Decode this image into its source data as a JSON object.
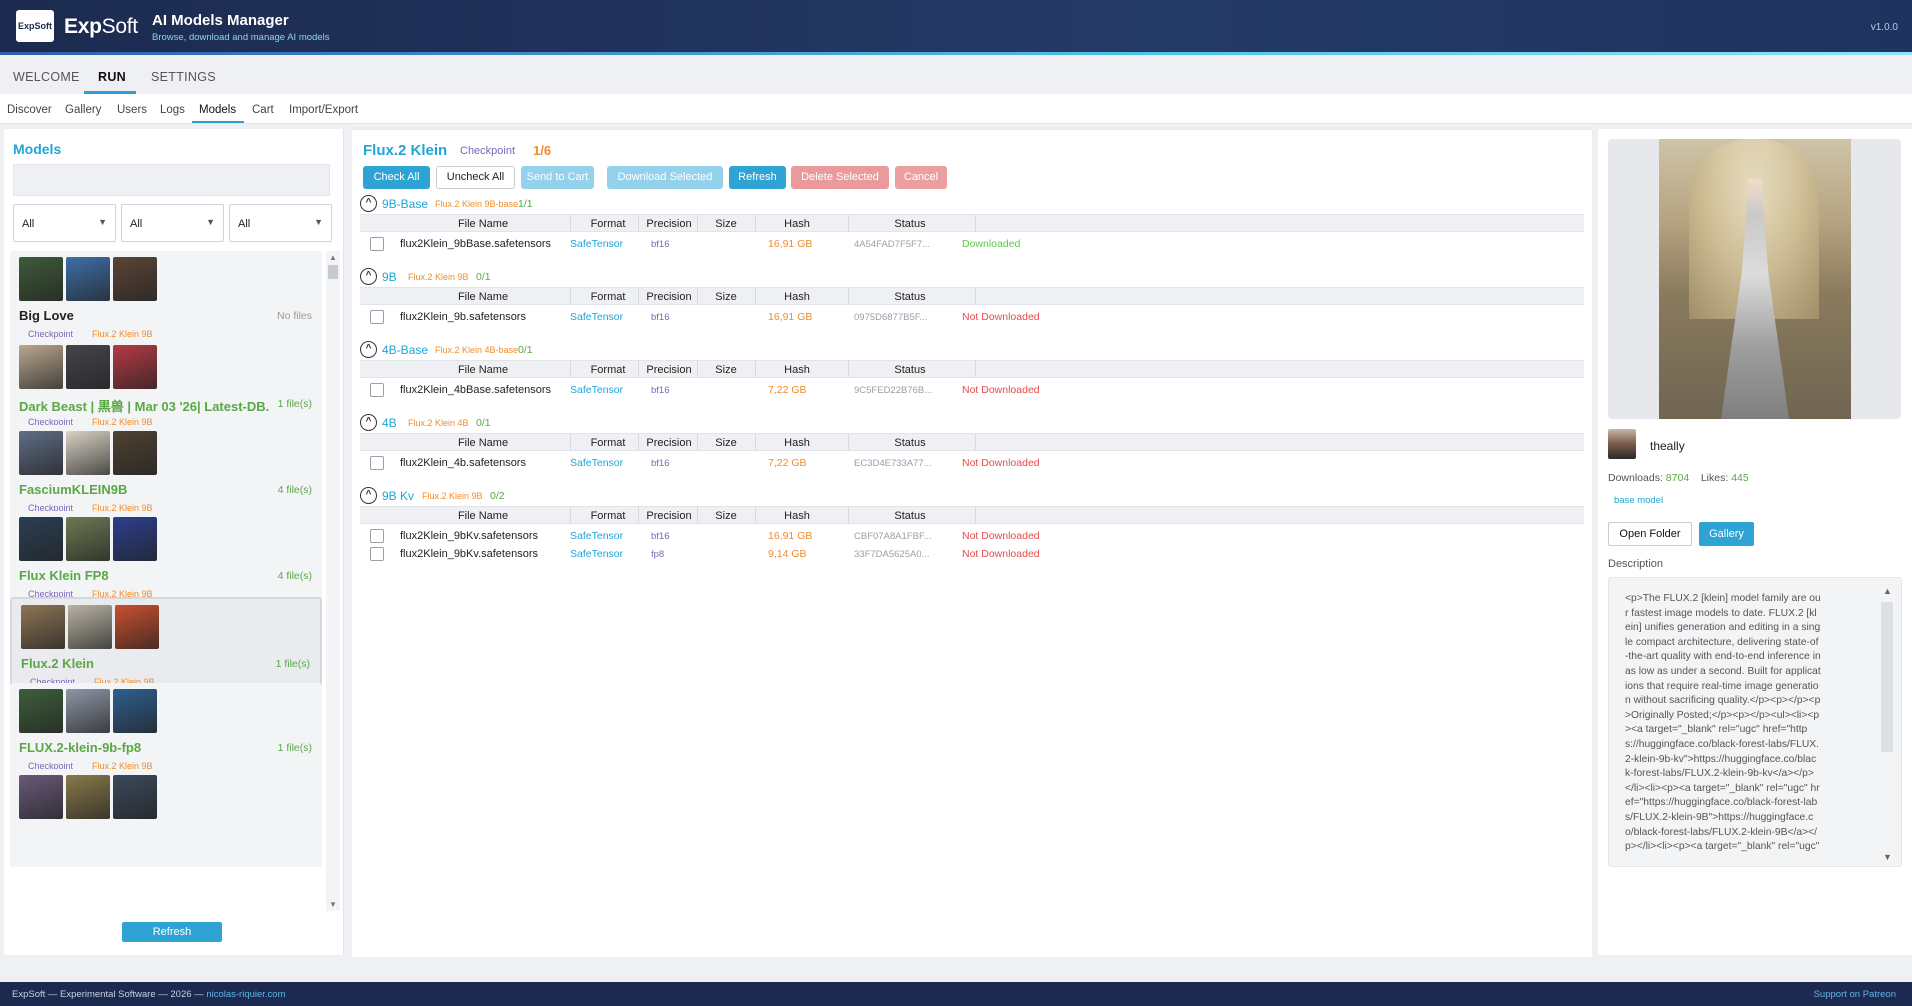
{
  "header": {
    "logo_text": "ExpSoft",
    "brand_main": "Exp",
    "brand_soft": "Soft",
    "app_title": "AI Models Manager",
    "app_subtitle": "Browse, download and manage AI models",
    "version": "v1.0.0"
  },
  "topnav": [
    "WELCOME",
    "RUN",
    "SETTINGS"
  ],
  "subnav": [
    "Discover",
    "Gallery",
    "Users",
    "Logs",
    "Models",
    "Cart",
    "Import/Export"
  ],
  "left": {
    "title": "Models",
    "filters": [
      "All",
      "All",
      "All"
    ],
    "refresh_label": "Refresh",
    "cards": [
      {
        "name": "Big Love",
        "files": "No files",
        "type": "Checkpoint",
        "base": "Flux.2 Klein 9B",
        "colors": [
          "#3e5b3a",
          "#3d6fa8",
          "#5b4536"
        ]
      },
      {
        "name": "Dark Beast | 黒兽 | Mar 03 '26| Latest-DB...",
        "files": "1 file(s)",
        "type": "Checkpoint",
        "base": "Flux.2 Klein 9B",
        "colors": [
          "#b9a78e",
          "#45444a",
          "#b53a44"
        ]
      },
      {
        "name": "FasciumKLEIN9B",
        "files": "4 file(s)",
        "type": "Checkpoint",
        "base": "Flux.2 Klein 9B",
        "colors": [
          "#5f6d86",
          "#d9d2c4",
          "#4e4232"
        ]
      },
      {
        "name": "Flux Klein FP8",
        "files": "4 file(s)",
        "type": "Checkpoint",
        "base": "Flux.2 Klein 9B",
        "colors": [
          "#2a3f54",
          "#6c7a52",
          "#2b3f8f"
        ]
      },
      {
        "name": "Flux.2 Klein",
        "files": "1 file(s)",
        "type": "Checkpoint",
        "base": "Flux.2 Klein 9B",
        "colors": [
          "#8d7553",
          "#b9b3a4",
          "#c9502e"
        ]
      },
      {
        "name": "FLUX.2-klein-9b-fp8",
        "files": "1 file(s)",
        "type": "Checkpoint",
        "base": "Flux.2 Klein 9B",
        "colors": [
          "#3d5f3a",
          "#8d96a7",
          "#2e5f8f"
        ]
      },
      {
        "name": "",
        "files": "",
        "type": "",
        "base": "",
        "colors": [
          "#6a5a7a",
          "#8a7a4a",
          "#3a4a5a"
        ]
      }
    ]
  },
  "center": {
    "title": "Flux.2 Klein",
    "type": "Checkpoint",
    "count": "1/6",
    "buttons": {
      "check_all": "Check All",
      "uncheck_all": "Uncheck All",
      "send_to_cart": "Send to Cart",
      "download_selected": "Download Selected",
      "refresh": "Refresh",
      "delete_selected": "Delete Selected",
      "cancel": "Cancel"
    },
    "columns": [
      "File Name",
      "Format",
      "Precision",
      "Size",
      "Hash",
      "Status"
    ],
    "groups": [
      {
        "name": "9B-Base",
        "base": "Flux.2 Klein 9B-base",
        "count": "1/1",
        "rows": [
          {
            "file": "flux2Klein_9bBase.safetensors",
            "format": "SafeTensor",
            "precision": "bf16",
            "size": "16,91 GB",
            "hash": "4A54FAD7F5F7...",
            "status": "Downloaded",
            "ok": true
          }
        ]
      },
      {
        "name": "9B",
        "base": "Flux.2 Klein 9B",
        "count": "0/1",
        "rows": [
          {
            "file": "flux2Klein_9b.safetensors",
            "format": "SafeTensor",
            "precision": "bf16",
            "size": "16,91 GB",
            "hash": "0975D6877B5F...",
            "status": "Not Downloaded",
            "ok": false
          }
        ]
      },
      {
        "name": "4B-Base",
        "base": "Flux.2 Klein 4B-base",
        "count": "0/1",
        "rows": [
          {
            "file": "flux2Klein_4bBase.safetensors",
            "format": "SafeTensor",
            "precision": "bf16",
            "size": "7,22 GB",
            "hash": "9C5FED22B76B...",
            "status": "Not Downloaded",
            "ok": false
          }
        ]
      },
      {
        "name": "4B",
        "base": "Flux.2 Klein 4B",
        "count": "0/1",
        "rows": [
          {
            "file": "flux2Klein_4b.safetensors",
            "format": "SafeTensor",
            "precision": "bf16",
            "size": "7,22 GB",
            "hash": "EC3D4E733A77...",
            "status": "Not Downloaded",
            "ok": false
          }
        ]
      },
      {
        "name": "9B Kv",
        "base": "Flux.2 Klein 9B",
        "count": "0/2",
        "rows": [
          {
            "file": "flux2Klein_9bKv.safetensors",
            "format": "SafeTensor",
            "precision": "bf16",
            "size": "16,91 GB",
            "hash": "CBF07A8A1FBF...",
            "status": "Not Downloaded",
            "ok": false
          },
          {
            "file": "flux2Klein_9bKv.safetensors",
            "format": "SafeTensor",
            "precision": "fp8",
            "size": "9,14 GB",
            "hash": "33F7DA5625A0...",
            "status": "Not Downloaded",
            "ok": false
          }
        ]
      }
    ]
  },
  "right": {
    "author": "theally",
    "downloads_label": "Downloads:",
    "downloads": "8704",
    "likes_label": "Likes:",
    "likes": "445",
    "tag": "base model",
    "open_folder": "Open Folder",
    "gallery": "Gallery",
    "description_label": "Description",
    "description": "<p>The FLUX.2 [klein] model family are our fastest image models to date. FLUX.2 [klein] unifies generation and editing in a single compact architecture, delivering state-of-the-art quality with end-to-end inference in as low as under a second. Built for applications that require real-time image generation without sacrificing quality.</p><p></p><p>Originally Posted;</p><p></p><ul><li><p><a target=\"_blank\" rel=\"ugc\" href=\"https://huggingface.co/black-forest-labs/FLUX.2-klein-9b-kv\">https://huggingface.co/black-forest-labs/FLUX.2-klein-9b-kv</a></p></li><li><p><a target=\"_blank\" rel=\"ugc\" href=\"https://huggingface.co/black-forest-labs/FLUX.2-klein-9B\">https://huggingface.co/black-forest-labs/FLUX.2-klein-9B</a></p></li><li><p><a target=\"_blank\" rel=\"ugc\""
  },
  "footer": {
    "left_text": "ExpSoft — Experimental Software — 2026 — ",
    "left_link": "nicolas-riquier.com",
    "right_link": "Support on Patreon"
  }
}
